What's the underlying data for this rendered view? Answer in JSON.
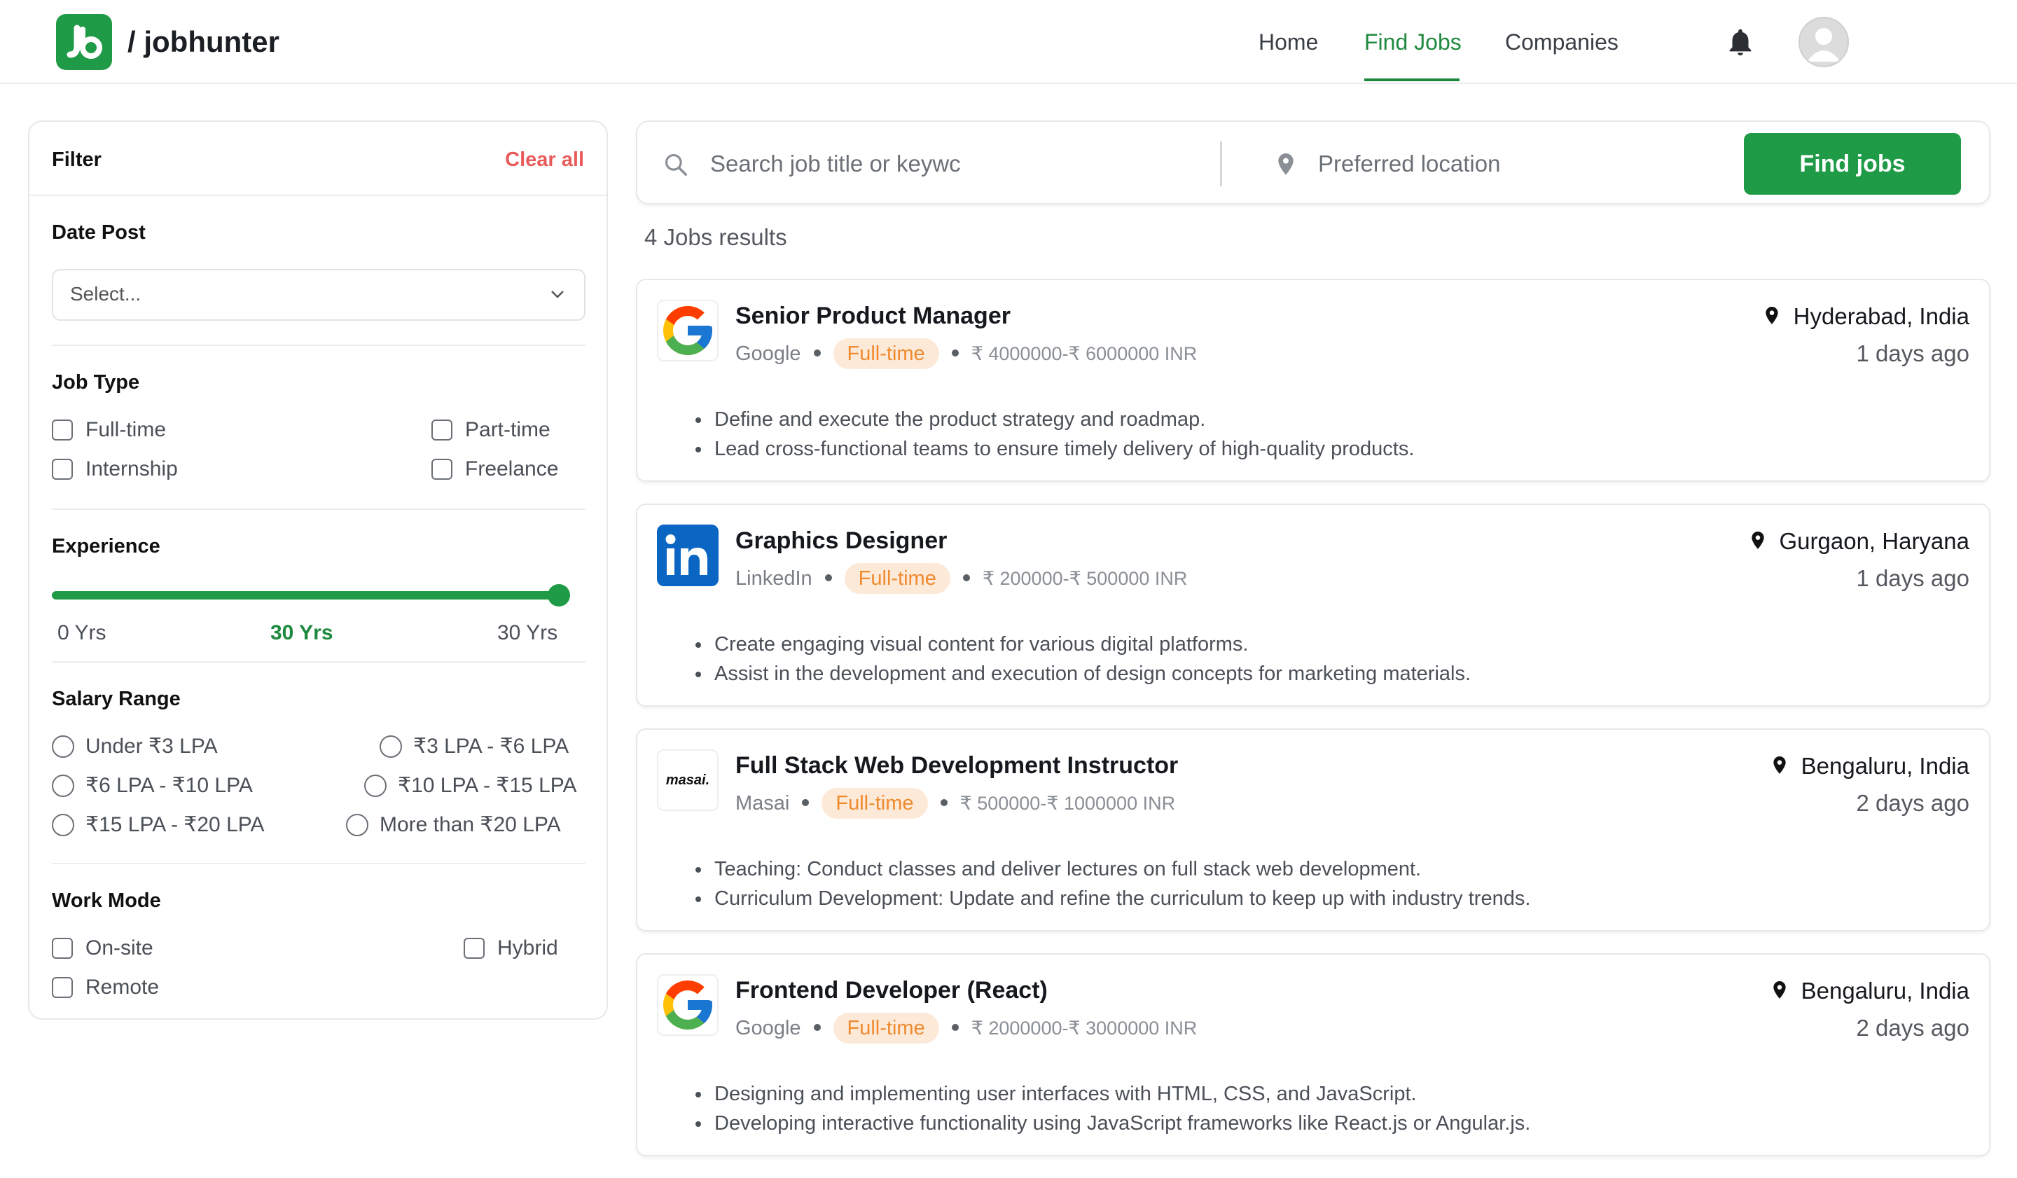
{
  "app": {
    "brand": "/ jobhunter"
  },
  "nav": {
    "home": "Home",
    "find_jobs": "Find Jobs",
    "companies": "Companies"
  },
  "filter": {
    "title": "Filter",
    "clear_all": "Clear all",
    "date_post": {
      "label": "Date Post",
      "placeholder": "Select..."
    },
    "job_type": {
      "label": "Job Type",
      "options": [
        "Full-time",
        "Part-time",
        "Internship",
        "Freelance"
      ]
    },
    "experience": {
      "label": "Experience",
      "min": "0 Yrs",
      "value": "30 Yrs",
      "max": "30 Yrs"
    },
    "salary_range": {
      "label": "Salary Range",
      "options": [
        "Under ₹3 LPA",
        "₹3 LPA - ₹6 LPA",
        "₹6 LPA - ₹10 LPA",
        "₹10 LPA - ₹15 LPA",
        "₹15 LPA - ₹20 LPA",
        "More than ₹20 LPA"
      ]
    },
    "work_mode": {
      "label": "Work Mode",
      "options": [
        "On-site",
        "Hybrid",
        "Remote"
      ]
    }
  },
  "search": {
    "query_placeholder": "Search job title or keywc",
    "location_placeholder": "Preferred location",
    "button": "Find jobs"
  },
  "results_count": "4 Jobs results",
  "jobs": [
    {
      "title": "Senior Product Manager",
      "company": "Google",
      "type": "Full-time",
      "salary": "₹ 4000000-₹ 6000000 INR",
      "location": "Hyderabad, India",
      "posted": "1 days ago",
      "bullets": [
        "Define and execute the product strategy and roadmap.",
        "Lead cross-functional teams to ensure timely delivery of high-quality products."
      ]
    },
    {
      "title": "Graphics Designer",
      "company": "LinkedIn",
      "type": "Full-time",
      "salary": "₹ 200000-₹ 500000 INR",
      "location": "Gurgaon, Haryana",
      "posted": "1 days ago",
      "bullets": [
        "Create engaging visual content for various digital platforms.",
        "Assist in the development and execution of design concepts for marketing materials."
      ]
    },
    {
      "title": "Full Stack Web Development Instructor",
      "company": "Masai",
      "type": "Full-time",
      "salary": "₹ 500000-₹ 1000000 INR",
      "location": "Bengaluru, India",
      "posted": "2 days ago",
      "bullets": [
        "Teaching: Conduct classes and deliver lectures on full stack web development.",
        "Curriculum Development: Update and refine the curriculum to keep up with industry trends."
      ]
    },
    {
      "title": "Frontend Developer (React)",
      "company": "Google",
      "type": "Full-time",
      "salary": "₹ 2000000-₹ 3000000 INR",
      "location": "Bengaluru, India",
      "posted": "2 days ago",
      "bullets": [
        "Designing and implementing user interfaces with HTML, CSS, and JavaScript.",
        "Developing interactive functionality using JavaScript frameworks like React.js or Angular.js."
      ]
    }
  ],
  "logos": {
    "masai": "masai."
  },
  "colors": {
    "brand_green": "#1f9a46",
    "clear_red": "#e85b5b",
    "badge_bg": "#fde9d8",
    "badge_text": "#ef8a2e"
  }
}
